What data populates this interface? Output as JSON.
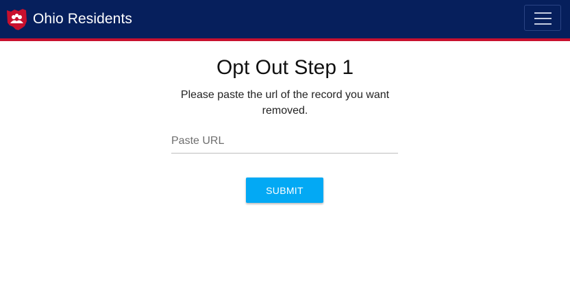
{
  "header": {
    "brand_name": "Ohio Residents",
    "logo_icon": "ohio-state-people-icon",
    "menu_icon": "hamburger-menu-icon",
    "colors": {
      "navbar_bg": "#061f5c",
      "stripe": "#c8102e",
      "logo_red": "#c8102e"
    }
  },
  "main": {
    "title": "Opt Out Step 1",
    "instructions": "Please paste the url of the record you want removed.",
    "url_input": {
      "placeholder": "Paste URL",
      "value": ""
    },
    "submit_label": "SUBMIT",
    "colors": {
      "submit_bg": "#03a9f4"
    }
  }
}
